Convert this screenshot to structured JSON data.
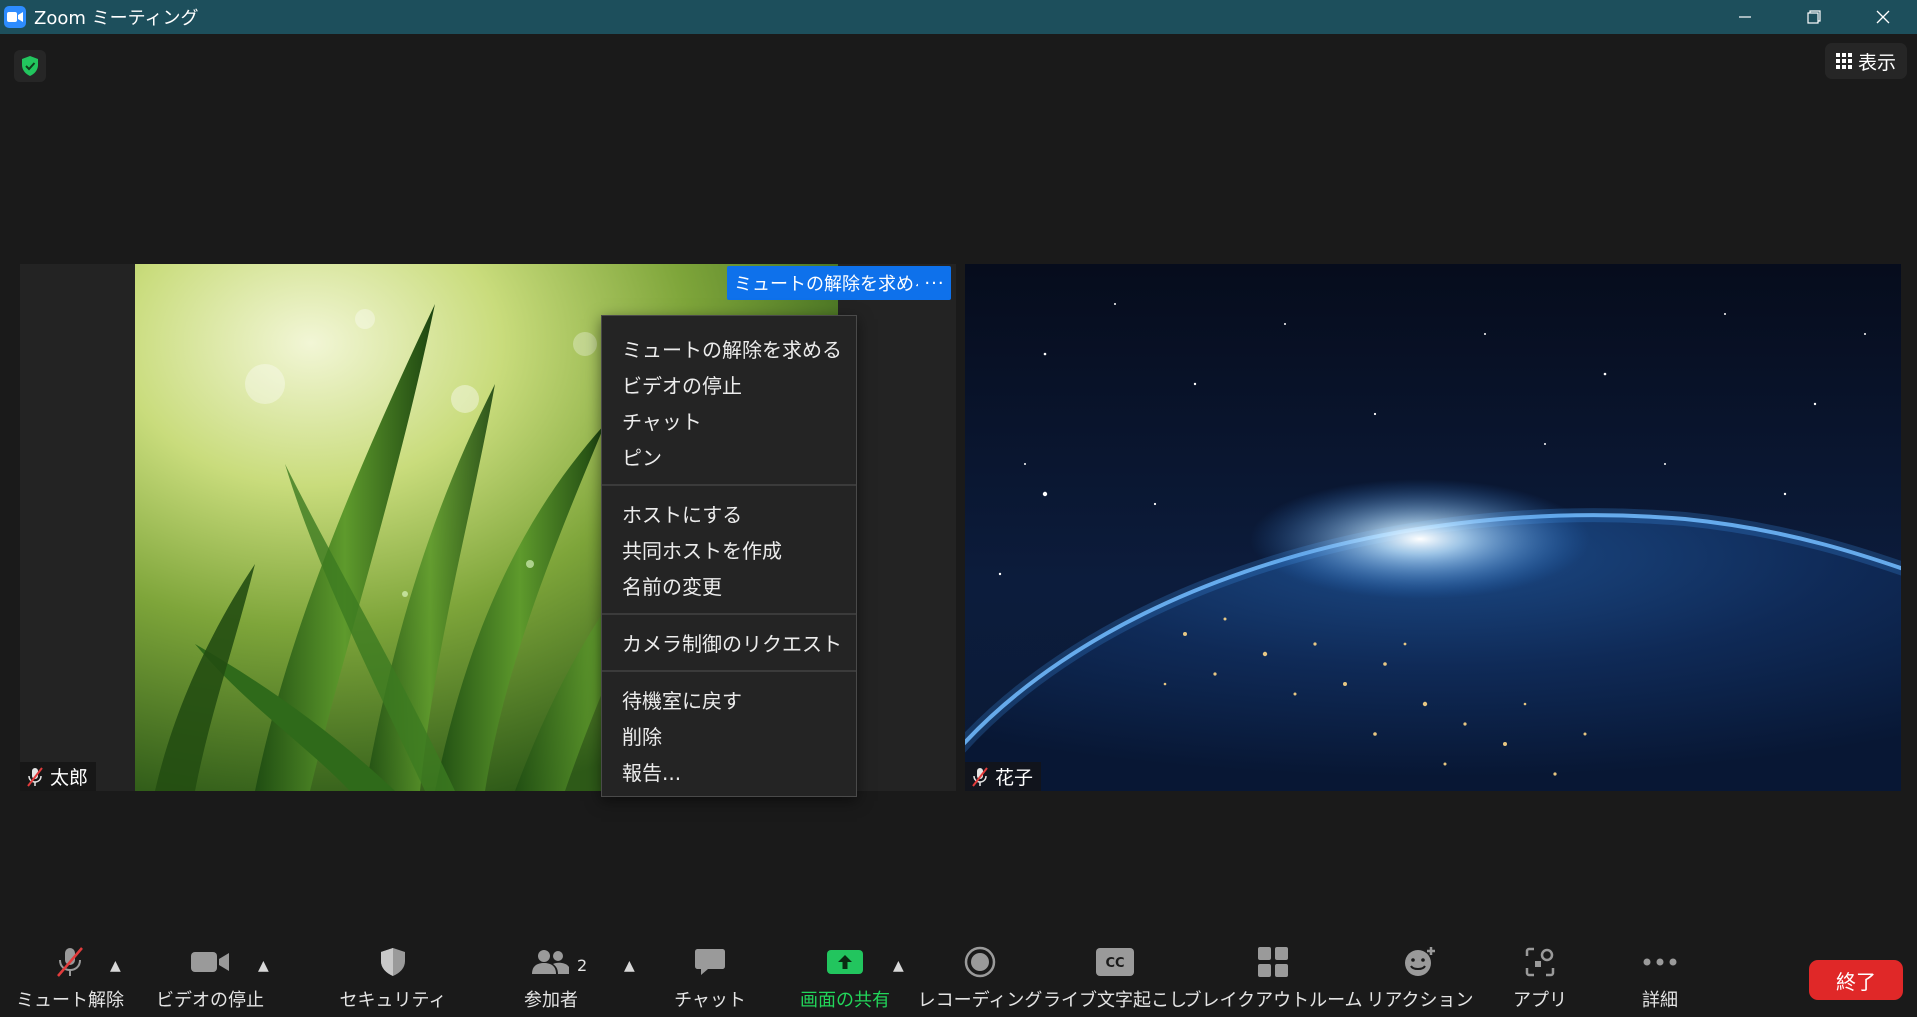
{
  "window": {
    "title": "Zoom ミーティング",
    "controls": [
      "minimize",
      "restore",
      "close"
    ]
  },
  "top_bar": {
    "security_badge": "shield-check-icon",
    "view_label": "表示"
  },
  "tiles": [
    {
      "name": "太郎",
      "muted": true,
      "background": "grass"
    },
    {
      "name": "花子",
      "muted": true,
      "background": "earth-space"
    }
  ],
  "hover_controls": {
    "ask_unmute_label": "ミュートの解除を求める",
    "more_label": "···"
  },
  "context_menu": {
    "groups": [
      [
        "ミュートの解除を求める",
        "ビデオの停止",
        "チャット",
        "ピン"
      ],
      [
        "ホストにする",
        "共同ホストを作成",
        "名前の変更"
      ],
      [
        "カメラ制御のリクエスト"
      ],
      [
        "待機室に戻す",
        "削除",
        "報告..."
      ]
    ]
  },
  "toolbar": {
    "unmute": "ミュート解除",
    "stop_video": "ビデオの停止",
    "security": "セキュリティ",
    "participants": "参加者",
    "participants_count": "2",
    "chat": "チャット",
    "share_screen": "画面の共有",
    "recording": "レコーディング",
    "live_transcript": "ライブ文字起こし",
    "cc_badge": "CC",
    "breakout": "ブレイクアウトルーム",
    "reactions": "リアクション",
    "apps": "アプリ",
    "more": "詳細",
    "end": "終了"
  },
  "colors": {
    "titlebar": "#1d4f5c",
    "accent_blue": "#0e71eb",
    "share_green": "#22d65a",
    "end_red": "#e02828"
  }
}
